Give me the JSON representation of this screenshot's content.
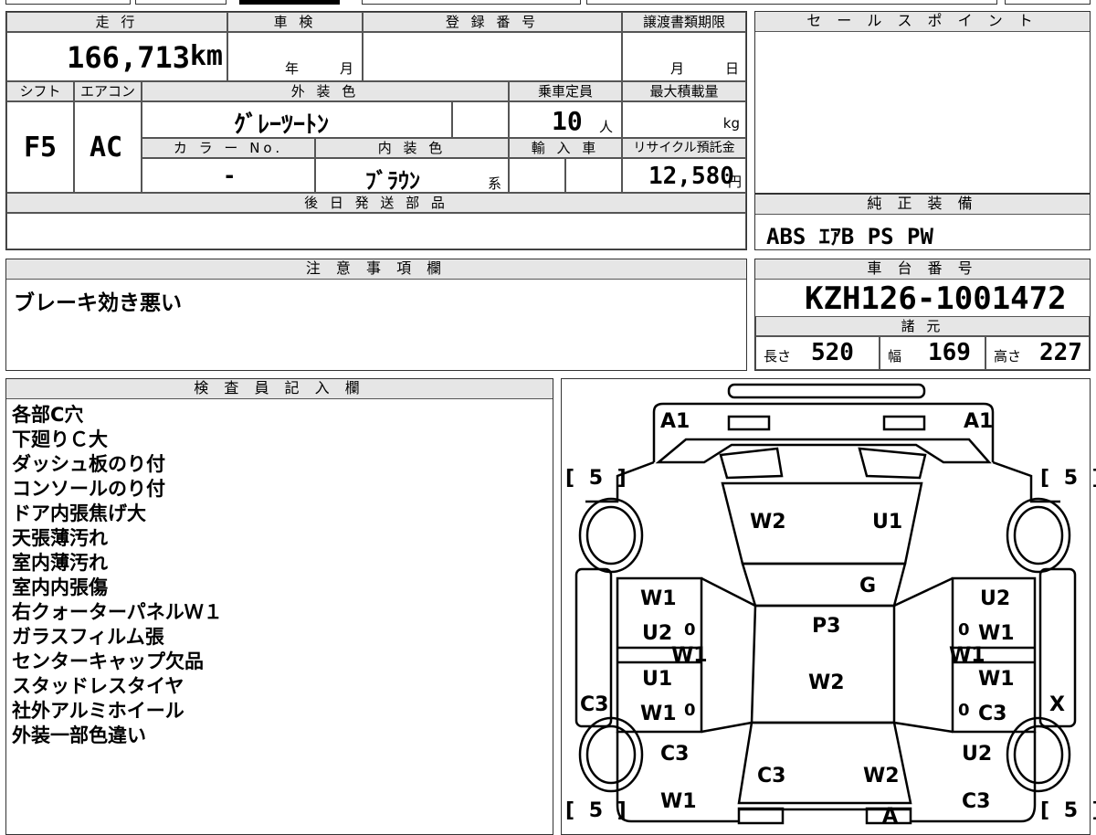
{
  "top_form": {
    "odometer": {
      "label": "走 行",
      "value": "166,713",
      "unit": "km"
    },
    "shaken": {
      "label": "車 検",
      "year_unit": "年",
      "month_unit": "月"
    },
    "registration": {
      "label": "登 録 番 号"
    },
    "transfer_deadline": {
      "label": "譲渡書類期限",
      "month_unit": "月",
      "day_unit": "日"
    },
    "shift": {
      "label": "シフト",
      "value": "F5"
    },
    "aircon": {
      "label": "エアコン",
      "value": "AC"
    },
    "exterior_color": {
      "label": "外 装 色",
      "value": "ｸﾞﾚｰﾂｰﾄﾝ"
    },
    "capacity": {
      "label": "乗車定員",
      "value": "10",
      "unit": "人"
    },
    "max_load": {
      "label": "最大積載量",
      "unit": "kg"
    },
    "color_no": {
      "label": "カ ラ ー No.",
      "value": "-"
    },
    "interior_color": {
      "label": "内 装 色",
      "value": "ﾌﾞﾗｳﾝ",
      "suffix": "系"
    },
    "import": {
      "label": "輸 入 車"
    },
    "recycle_fee": {
      "label": "リサイクル預託金",
      "value": "12,580",
      "unit": "円"
    },
    "later_parts": {
      "label": "後 日 発 送 部 品"
    }
  },
  "sales_point": {
    "label": "セ ー ル ス ポ イ ン ト"
  },
  "equipment": {
    "label": "純 正 装 備",
    "value": "ABS ｴｱB PS PW"
  },
  "notes": {
    "label": "注 意 事 項 欄",
    "value": "ブレーキ効き悪い"
  },
  "chassis": {
    "label": "車 台 番 号",
    "value": "KZH126-1001472"
  },
  "specs": {
    "label": "諸 元",
    "length": {
      "label": "長さ",
      "value": "520"
    },
    "width": {
      "label": "幅",
      "value": "169"
    },
    "height": {
      "label": "高さ",
      "value": "227"
    }
  },
  "inspector": {
    "label": "検 査 員 記 入 欄",
    "lines": [
      "各部C穴",
      "下廻りＣ大",
      "ダッシュ板のり付",
      "コンソールのり付",
      "ドア内張焦げ大",
      "天張薄汚れ",
      "室内薄汚れ",
      "室内内張傷",
      "右クォーターパネルＷ１",
      "ガラスフィルム張",
      "センターキャップ欠品",
      "スタッドレスタイヤ",
      "社外アルミホイール",
      "外装一部色違い"
    ]
  },
  "diagram": {
    "marks": {
      "front_left": "A1",
      "front_right": "A1",
      "tire_fl": "[ 5 ]",
      "tire_fr": "[ 5 ]",
      "tire_rl": "[ 5 ]",
      "tire_rr": "[ 5 ]",
      "windshield_left": "W2",
      "windshield_right": "U1",
      "roof_front": "G",
      "roof": "P3",
      "roof_rear": "W2",
      "left_door_front_1": "W1",
      "left_door_front_2": "U2",
      "left_door_front_zero": "0",
      "left_door_mid": "W1",
      "left_door_rear_1": "U1",
      "left_door_rear_2": "W1",
      "left_door_rear_zero": "0",
      "right_door_front_1": "U2",
      "right_door_front_2": "W1",
      "right_door_front_zero": "0",
      "right_door_mid": "W1",
      "right_door_rear_1": "W1",
      "right_door_rear_2": "C3",
      "right_door_rear_zero": "0",
      "left_side": "C3",
      "right_side": "X",
      "left_rear_quarter": "C3",
      "left_rear_bottom": "W1",
      "rear_glass_left": "C3",
      "rear_glass_right": "W2",
      "right_rear_quarter": "U2",
      "right_rear_bottom": "C3",
      "rear_bottom": "A"
    }
  }
}
